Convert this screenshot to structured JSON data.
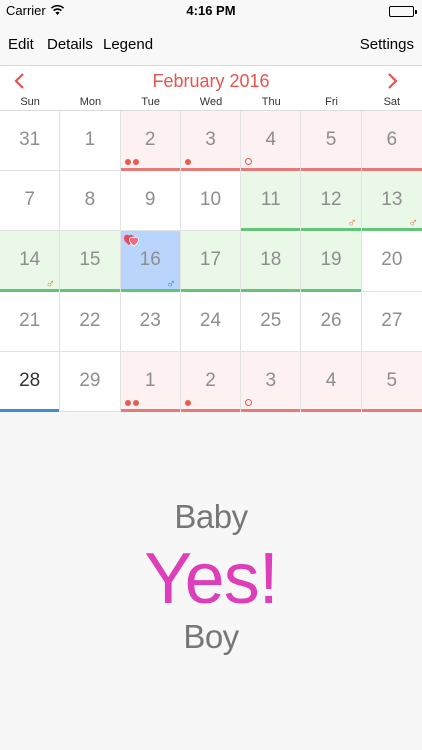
{
  "status_bar": {
    "carrier": "Carrier",
    "time": "4:16 PM"
  },
  "toolbar": {
    "edit": "Edit",
    "details": "Details",
    "legend": "Legend",
    "settings": "Settings"
  },
  "calendar": {
    "month_title": "February 2016",
    "weekdays": [
      "Sun",
      "Mon",
      "Tue",
      "Wed",
      "Thu",
      "Fri",
      "Sat"
    ],
    "days": [
      {
        "n": "31",
        "type": "",
        "bar": "",
        "dots": 0,
        "hollow": false,
        "sym": "",
        "heart": false,
        "today": false
      },
      {
        "n": "1",
        "type": "",
        "bar": "",
        "dots": 0,
        "hollow": false,
        "sym": "",
        "heart": false,
        "today": false
      },
      {
        "n": "2",
        "type": "period",
        "bar": "red",
        "dots": 2,
        "hollow": false,
        "sym": "",
        "heart": false,
        "today": false
      },
      {
        "n": "3",
        "type": "period",
        "bar": "red",
        "dots": 1,
        "hollow": false,
        "sym": "",
        "heart": false,
        "today": false
      },
      {
        "n": "4",
        "type": "period",
        "bar": "red",
        "dots": 0,
        "hollow": true,
        "sym": "",
        "heart": false,
        "today": false
      },
      {
        "n": "5",
        "type": "period",
        "bar": "red",
        "dots": 0,
        "hollow": false,
        "sym": "",
        "heart": false,
        "today": false
      },
      {
        "n": "6",
        "type": "period",
        "bar": "red",
        "dots": 0,
        "hollow": false,
        "sym": "",
        "heart": false,
        "today": false
      },
      {
        "n": "7",
        "type": "",
        "bar": "",
        "dots": 0,
        "hollow": false,
        "sym": "",
        "heart": false,
        "today": false
      },
      {
        "n": "8",
        "type": "",
        "bar": "",
        "dots": 0,
        "hollow": false,
        "sym": "",
        "heart": false,
        "today": false
      },
      {
        "n": "9",
        "type": "",
        "bar": "",
        "dots": 0,
        "hollow": false,
        "sym": "",
        "heart": false,
        "today": false
      },
      {
        "n": "10",
        "type": "",
        "bar": "",
        "dots": 0,
        "hollow": false,
        "sym": "",
        "heart": false,
        "today": false
      },
      {
        "n": "11",
        "type": "fertile",
        "bar": "green",
        "dots": 0,
        "hollow": false,
        "sym": "",
        "heart": false,
        "today": false
      },
      {
        "n": "12",
        "type": "fertile",
        "bar": "green",
        "dots": 0,
        "hollow": false,
        "sym": "♂",
        "heart": false,
        "today": false
      },
      {
        "n": "13",
        "type": "fertile",
        "bar": "green",
        "dots": 0,
        "hollow": false,
        "sym": "♂",
        "heart": false,
        "today": false
      },
      {
        "n": "14",
        "type": "fertile",
        "bar": "green",
        "dots": 0,
        "hollow": false,
        "sym": "♂",
        "heart": false,
        "today": false
      },
      {
        "n": "15",
        "type": "fertile",
        "bar": "green",
        "dots": 0,
        "hollow": false,
        "sym": "",
        "heart": false,
        "today": false
      },
      {
        "n": "16",
        "type": "selected",
        "bar": "green",
        "dots": 0,
        "hollow": false,
        "sym": "♂",
        "heart": true,
        "today": false
      },
      {
        "n": "17",
        "type": "fertile",
        "bar": "green",
        "dots": 0,
        "hollow": false,
        "sym": "",
        "heart": false,
        "today": false
      },
      {
        "n": "18",
        "type": "fertile",
        "bar": "green",
        "dots": 0,
        "hollow": false,
        "sym": "",
        "heart": false,
        "today": false
      },
      {
        "n": "19",
        "type": "fertile",
        "bar": "green",
        "dots": 0,
        "hollow": false,
        "sym": "",
        "heart": false,
        "today": false
      },
      {
        "n": "20",
        "type": "",
        "bar": "",
        "dots": 0,
        "hollow": false,
        "sym": "",
        "heart": false,
        "today": false
      },
      {
        "n": "21",
        "type": "",
        "bar": "",
        "dots": 0,
        "hollow": false,
        "sym": "",
        "heart": false,
        "today": false
      },
      {
        "n": "22",
        "type": "",
        "bar": "",
        "dots": 0,
        "hollow": false,
        "sym": "",
        "heart": false,
        "today": false
      },
      {
        "n": "23",
        "type": "",
        "bar": "",
        "dots": 0,
        "hollow": false,
        "sym": "",
        "heart": false,
        "today": false
      },
      {
        "n": "24",
        "type": "",
        "bar": "",
        "dots": 0,
        "hollow": false,
        "sym": "",
        "heart": false,
        "today": false
      },
      {
        "n": "25",
        "type": "",
        "bar": "",
        "dots": 0,
        "hollow": false,
        "sym": "",
        "heart": false,
        "today": false
      },
      {
        "n": "26",
        "type": "",
        "bar": "",
        "dots": 0,
        "hollow": false,
        "sym": "",
        "heart": false,
        "today": false
      },
      {
        "n": "27",
        "type": "",
        "bar": "",
        "dots": 0,
        "hollow": false,
        "sym": "",
        "heart": false,
        "today": false
      },
      {
        "n": "28",
        "type": "",
        "bar": "blue",
        "dots": 0,
        "hollow": false,
        "sym": "",
        "heart": false,
        "today": true
      },
      {
        "n": "29",
        "type": "",
        "bar": "",
        "dots": 0,
        "hollow": false,
        "sym": "",
        "heart": false,
        "today": false
      },
      {
        "n": "1",
        "type": "period",
        "bar": "red",
        "dots": 2,
        "hollow": false,
        "sym": "",
        "heart": false,
        "today": false
      },
      {
        "n": "2",
        "type": "period",
        "bar": "red",
        "dots": 1,
        "hollow": false,
        "sym": "",
        "heart": false,
        "today": false
      },
      {
        "n": "3",
        "type": "period",
        "bar": "red",
        "dots": 0,
        "hollow": true,
        "sym": "",
        "heart": false,
        "today": false
      },
      {
        "n": "4",
        "type": "period",
        "bar": "red",
        "dots": 0,
        "hollow": false,
        "sym": "",
        "heart": false,
        "today": false
      },
      {
        "n": "5",
        "type": "period",
        "bar": "red",
        "dots": 0,
        "hollow": false,
        "sym": "",
        "heart": false,
        "today": false
      }
    ]
  },
  "prediction": {
    "top": "Baby",
    "main": "Yes!",
    "bottom": "Boy"
  },
  "colors": {
    "accent": "#e8544e",
    "period_bg": "#fdf1f1",
    "fertile_bg": "#eaf8e8",
    "selected_bg": "#b9d5fb",
    "main_text": "#dc3fb9"
  },
  "icons": [
    "wifi-icon",
    "battery-icon",
    "chevron-left-icon",
    "chevron-right-icon",
    "heart-icon",
    "male-symbol-icon"
  ]
}
